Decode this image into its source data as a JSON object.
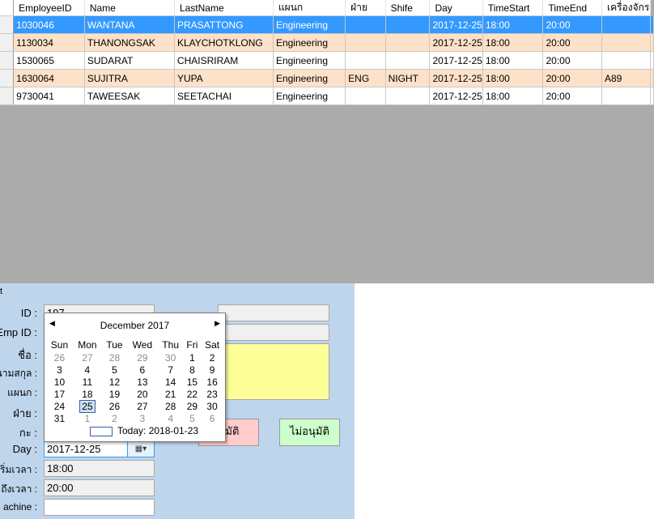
{
  "grid": {
    "columns": [
      "EmployeeID",
      "Name",
      "LastName",
      "แผนก",
      "ฝ่าย",
      "Shife",
      "Day",
      "TimeStart",
      "TimeEnd",
      "เครื่องจักร"
    ],
    "rows": [
      {
        "style": "sel",
        "cells": [
          "1030046",
          "WANTANA",
          "PRASATTONG",
          "Engineering",
          "",
          "",
          "2017-12-25",
          "18:00",
          "20:00",
          ""
        ]
      },
      {
        "style": "alt",
        "cells": [
          "1130034",
          "THANONGSAK",
          "KLAYCHOTKLONG",
          "Engineering",
          "",
          "",
          "2017-12-25",
          "18:00",
          "20:00",
          ""
        ]
      },
      {
        "style": "norm",
        "cells": [
          "1530065",
          "SUDARAT",
          "CHAISRIRAM",
          "Engineering",
          "",
          "",
          "2017-12-25",
          "18:00",
          "20:00",
          ""
        ]
      },
      {
        "style": "alt",
        "cells": [
          "1630064",
          "SUJITRA",
          "YUPA",
          "Engineering",
          "ENG",
          "NIGHT",
          "2017-12-25",
          "18:00",
          "20:00",
          "A89"
        ]
      },
      {
        "style": "norm",
        "cells": [
          "9730041",
          "TAWEESAK",
          "SEETACHAI",
          "Engineering",
          "",
          "",
          "2017-12-25",
          "18:00",
          "20:00",
          ""
        ]
      }
    ]
  },
  "form": {
    "corner_label": "t",
    "id_label": "ID :",
    "id_value": "197",
    "empid_label": "Emp ID :",
    "name_label": "ชื่อ :",
    "lastname_label": "นามสกุล :",
    "dept_label": "แผนก :",
    "div_label": "ฝ่าย :",
    "shift_label": "กะ :",
    "day_label": "Day :",
    "day_value": "2017-12-25",
    "start_label": "เริ่มเวลา :",
    "start_value": "18:00",
    "end_label": "ถึงเวลา :",
    "end_value": "20:00",
    "machine_label": "achine :",
    "machine_value": "",
    "approve_label": "นุมัติ",
    "reject_label": "ไม่อนุมัติ",
    "colors": {
      "panel": "#bfd5ec",
      "note": "#ffff99",
      "approve": "#ffcccc",
      "reject": "#ccffcc"
    }
  },
  "calendar": {
    "month_title": "December 2017",
    "weekdays": [
      "Sun",
      "Mon",
      "Tue",
      "Wed",
      "Thu",
      "Fri",
      "Sat"
    ],
    "weeks": [
      [
        "26",
        "27",
        "28",
        "29",
        "30",
        "1",
        "2"
      ],
      [
        "3",
        "4",
        "5",
        "6",
        "7",
        "8",
        "9"
      ],
      [
        "10",
        "11",
        "12",
        "13",
        "14",
        "15",
        "16"
      ],
      [
        "17",
        "18",
        "19",
        "20",
        "21",
        "22",
        "23"
      ],
      [
        "24",
        "25",
        "26",
        "27",
        "28",
        "29",
        "30"
      ],
      [
        "31",
        "1",
        "2",
        "3",
        "4",
        "5",
        "6"
      ]
    ],
    "selected": "25",
    "today_text": "Today: 2018-01-23"
  }
}
